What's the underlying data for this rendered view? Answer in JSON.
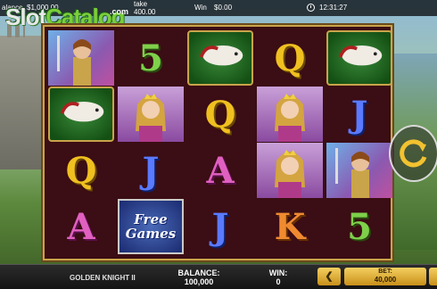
{
  "topbar": {
    "balance_label": "alance",
    "balance_value": "$1,000.00",
    "stake_label": "take",
    "stake_value": "400.00",
    "win_label": "Win",
    "win_value": "$0.00",
    "clock_icon": "clock-icon",
    "time": "12:31:27"
  },
  "watermark": {
    "slot": "Slot",
    "catalog": "Catalog",
    "com": ".com"
  },
  "reels": [
    [
      "knight",
      "horse",
      "Q",
      "A"
    ],
    [
      "5",
      "princess",
      "J",
      "free"
    ],
    [
      "horse",
      "Q",
      "A",
      "J"
    ],
    [
      "Q",
      "princess",
      "princess",
      "K"
    ],
    [
      "horse",
      "J",
      "knight",
      "5"
    ]
  ],
  "symbols": {
    "free_line1": "Free",
    "free_line2": "Games"
  },
  "spin": {
    "icon": "spin-arrow-icon"
  },
  "bottombar": {
    "title": "GOLDEN KNIGHT II",
    "balance_label": "BALANCE:",
    "balance_value": "100,000",
    "win_label": "WIN:",
    "win_value": "0",
    "decrease_icon": "chevron-left-icon",
    "bet_label": "BET:",
    "bet_value": "40,000"
  },
  "colors": {
    "frame_gold": "#c9a44a",
    "reel_bg": "#3b0d14",
    "button_gold": "#e0b040"
  }
}
